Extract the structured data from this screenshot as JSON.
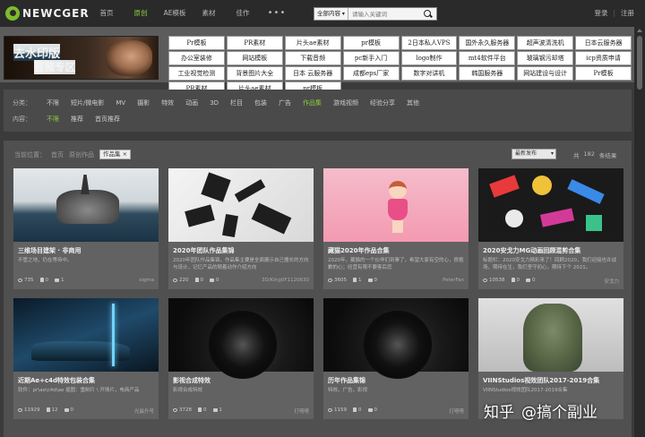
{
  "nav": {
    "logo": "NEWCGER",
    "links": [
      "首页",
      "原创",
      "AE模板",
      "素材",
      "佳作"
    ],
    "active_index": 1,
    "more": "•••",
    "search_scope": "全部内容",
    "search_placeholder": "请输入关键词",
    "login": "登录",
    "sep": "|",
    "register": "注册"
  },
  "banner": {
    "line1": "去水印版",
    "line2": "音频专区"
  },
  "ads": [
    "Pr模板",
    "PR素材",
    "片头ae素材",
    "pr模板",
    "2日本私人VPS",
    "国外永久服务器",
    "超声波清洗机",
    "日本云服务器",
    "办公室装修",
    "网站模板",
    "下载音频",
    "pc新手入门",
    "logo制作",
    "mt4软件平台",
    "玻璃钢污却塔",
    "icp资质申请",
    "工业视觉检测",
    "背景图片大全",
    "日本 云服务器",
    "成都eps厂家",
    "数字对讲机",
    "韩国服务器",
    "网站建设与设计",
    "Pr模板",
    "PR素材",
    "片头ae素材",
    "pr模板"
  ],
  "filters": {
    "category_label": "分类：",
    "categories": [
      "不限",
      "短片/微电影",
      "MV",
      "摄影",
      "特效",
      "动画",
      "3D",
      "栏目",
      "包装",
      "广告",
      "作品集",
      "游戏视频",
      "经验分享",
      "其他"
    ],
    "category_selected": 10,
    "content_label": "内容：",
    "contents": [
      "不限",
      "推荐",
      "首页推荐"
    ],
    "content_selected": 0
  },
  "breadcrumb": {
    "label": "当前位置：",
    "home": "首页",
    "section": "原创作品",
    "tag": "作品集 ×"
  },
  "sort": "最新发布",
  "result": {
    "prefix": "共",
    "count": "182",
    "suffix": "条结果"
  },
  "cards": [
    {
      "title": "三维场目建架 · 非商用",
      "desc": "不管之地，仍在等待中。",
      "views": "735",
      "likes": "0",
      "comments": "1",
      "author": "sigma"
    },
    {
      "title": "2020年团队作品集锦",
      "desc": "2020年团队作品集锦，作品集主要是全面展示自己擅长的方向与设计，记忆产品的随着动作介绍方向",
      "views": "220",
      "likes": "0",
      "comments": "0",
      "author": "3D/King0F1120630"
    },
    {
      "title": "藏猫2020年作品合集",
      "desc": "2020年，藏猫的一个伙伴们到寨了，希望大家有空的心，很抱歉的心；经营有限不要客后您",
      "views": "3605",
      "likes": "1",
      "comments": "0",
      "author": "PeterFan"
    },
    {
      "title": "2020安戈力MG动画回顾混剪合集",
      "desc": "标题栏：2020安戈力精彩来了！回顾2020，我们迎接也许战场，期待在生，我们坚守初心，期待下个 2021。",
      "views": "10538",
      "likes": "0",
      "comments": "0",
      "author": "安戈力"
    },
    {
      "title": "近期Ae+c4d特效包装合集",
      "desc": "软件：pr\\ae\\c4d\\ae 插图：重制片 \\ 开场片，电商产品",
      "views": "11929",
      "likes": "12",
      "comments": "0",
      "author": "光晨升号"
    },
    {
      "title": "影视合成特效",
      "desc": "影视合成特效",
      "views": "3728",
      "likes": "0",
      "comments": "1",
      "author": "打嗒嗒"
    },
    {
      "title": "历年作品集锦",
      "desc": "特效，广告，影视",
      "views": "1159",
      "likes": "0",
      "comments": "0",
      "author": "打嗒嗒"
    },
    {
      "title": "VIINStudios视效团队2017-2019合集",
      "desc": "VIINStudios视效团队2017-2019合集",
      "views": "",
      "likes": "",
      "comments": "",
      "author": ""
    }
  ],
  "watermark": {
    "logo": "知乎",
    "text": "@搞个副业"
  }
}
